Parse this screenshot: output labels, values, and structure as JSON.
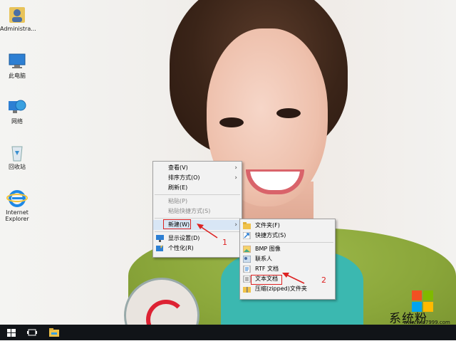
{
  "desktop_icons": [
    {
      "name": "administrator-icon",
      "label": "Administra..."
    },
    {
      "name": "this-pc-icon",
      "label": "此电脑"
    },
    {
      "name": "network-icon",
      "label": "网络"
    },
    {
      "name": "recycle-bin-icon",
      "label": "回收站"
    },
    {
      "name": "internet-explorer-icon",
      "label": "Internet Explorer"
    }
  ],
  "context_menu": {
    "items": [
      {
        "label": "查看(V)"
      },
      {
        "label": "排序方式(O)"
      },
      {
        "label": "刷新(E)"
      },
      {
        "label": "粘贴(P)"
      },
      {
        "label": "粘贴快捷方式(S)"
      },
      {
        "label": "新建(W)"
      },
      {
        "label": "显示设置(D)"
      },
      {
        "label": "个性化(R)"
      }
    ]
  },
  "new_submenu": {
    "items": [
      {
        "label": "文件夹(F)"
      },
      {
        "label": "快捷方式(S)"
      },
      {
        "label": "BMP 图像"
      },
      {
        "label": "联系人"
      },
      {
        "label": "RTF 文档"
      },
      {
        "label": "文本文档"
      },
      {
        "label": "压缩(zipped)文件夹"
      }
    ]
  },
  "annotations": {
    "step1": "1",
    "step2": "2"
  },
  "watermark": {
    "title": "系统粉",
    "url": "www.win7999.com"
  },
  "colors": {
    "annotation": "#dd2222",
    "menu_bg": "#f2f2f2",
    "taskbar": "#111418",
    "folder": "#f0c24a"
  }
}
